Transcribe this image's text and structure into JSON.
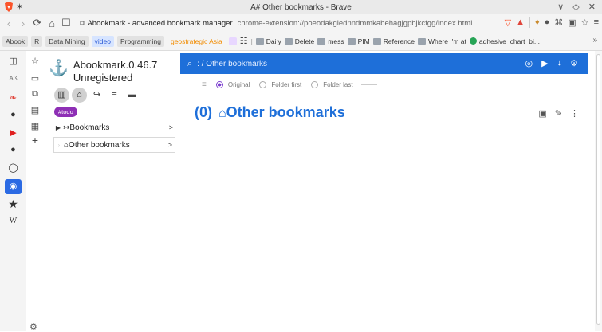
{
  "window": {
    "title": "A# Other bookmarks - Brave",
    "controls": "∨ ◇ ✕"
  },
  "nav": {
    "back": "‹",
    "forward": "›",
    "reload": "⟳",
    "home": "⌂",
    "bookmark": "☐",
    "site_name": "Abookmark - advanced bookmark manager",
    "url": "chrome-extension://poeodakgiednndmmkabehagjgpbjkcfgg/index.html"
  },
  "bookmarks_bar": {
    "chips": [
      "Abook",
      "R",
      "Data Mining",
      "video",
      "Programming",
      "geostrategic Asia"
    ],
    "folders": [
      "Daily",
      "Delete",
      "mess",
      "PIM",
      "Reference",
      "Where I'm at"
    ],
    "link": "adhesive_chart_bi...",
    "more": "»"
  },
  "app": {
    "name": "Abookmark.0.46.7",
    "status": "Unregistered",
    "tag": "#todo",
    "tree": [
      {
        "label": "↣Bookmarks",
        "arrow": ">"
      },
      {
        "label": "⌂Other bookmarks",
        "arrow": ">"
      }
    ]
  },
  "main": {
    "breadcrumb": ": / Other bookmarks",
    "sort_options": [
      "Original",
      "Folder first",
      "Folder last"
    ],
    "selected_sort": "Original",
    "heading_count": "(0)",
    "heading_title": "Other bookmarks"
  }
}
